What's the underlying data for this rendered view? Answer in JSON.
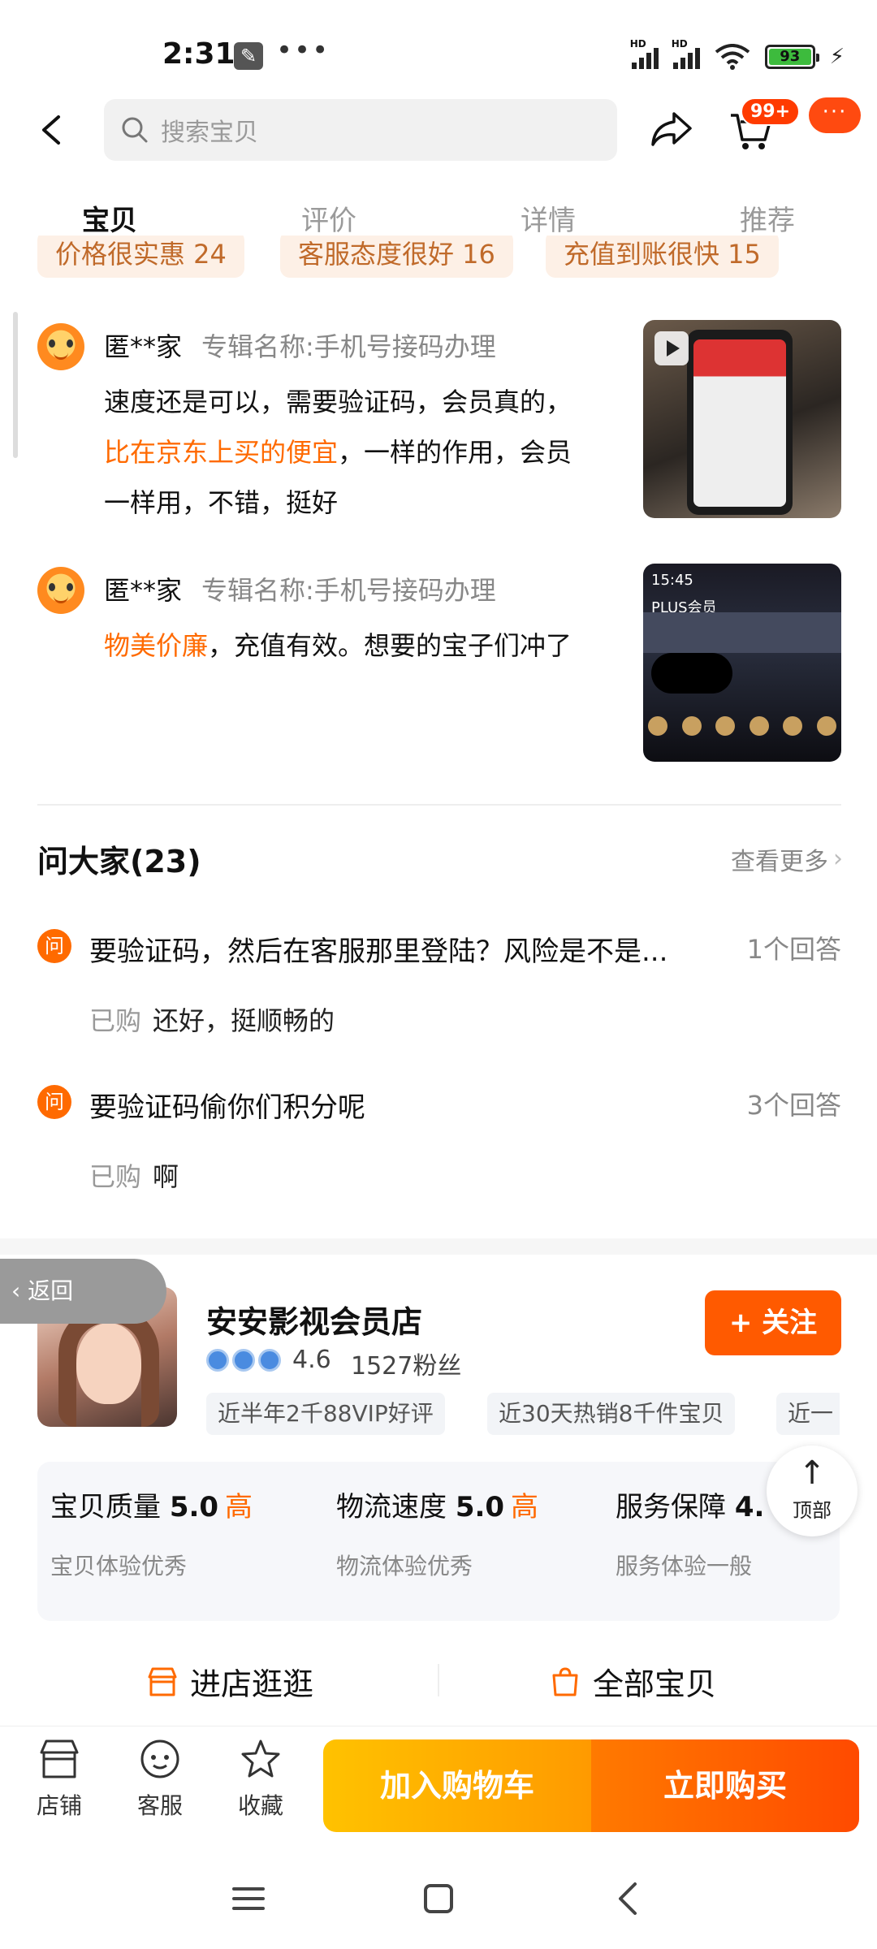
{
  "status_bar": {
    "time": "2:31",
    "battery": "93",
    "network_label": "HD"
  },
  "header": {
    "search_placeholder": "搜索宝贝",
    "cart_badge": "99+",
    "more_label": "···"
  },
  "tabs": [
    {
      "label": "宝贝",
      "active": true
    },
    {
      "label": "评价",
      "active": false
    },
    {
      "label": "详情",
      "active": false
    },
    {
      "label": "推荐",
      "active": false
    }
  ],
  "review_tags": [
    "价格很实惠 24",
    "客服态度很好 16",
    "充值到账很快 15"
  ],
  "reviews": [
    {
      "user": "匿**家",
      "sku": "专辑名称:手机号接码办理",
      "text_before": "速度还是可以，需要验证码，会员真的，",
      "highlight": "比在京东上买的便宜",
      "text_after": "，一样的作用，会员一样用，不错，挺好"
    },
    {
      "user": "匿**家",
      "sku": "专辑名称:手机号接码办理",
      "text_before": "",
      "highlight": "物美价廉",
      "text_after": "，充值有效。想要的宝子们冲了"
    }
  ],
  "review_thumb_text": {
    "time": "15:45",
    "title": "PLUS会员"
  },
  "qa": {
    "title": "问大家(23)",
    "more": "查看更多",
    "icon_char": "问",
    "questions": [
      {
        "q": "要验证码，然后在客服那里登陆？风险是不是...",
        "count": "1个回答",
        "tag": "已购",
        "a": "还好，挺顺畅的"
      },
      {
        "q": "要验证码偷你们积分呢",
        "count": "3个回答",
        "tag": "已购",
        "a": "啊"
      }
    ]
  },
  "shop": {
    "return_label": "返回",
    "name": "安安影视会员店",
    "follow_label": "+ 关注",
    "rating": "4.6",
    "fans": "1527粉丝",
    "tags": [
      "近半年2千88VIP好评",
      "近30天热销8千件宝贝",
      "近一"
    ],
    "scores": [
      {
        "label": "宝贝质量",
        "score": "5.0",
        "level": "高",
        "sub": "宝贝体验优秀"
      },
      {
        "label": "物流速度",
        "score": "5.0",
        "level": "高",
        "sub": "物流体验优秀"
      },
      {
        "label": "服务保障",
        "score": "4.",
        "level": "",
        "sub": "服务体验一般"
      }
    ],
    "top_label": "顶部",
    "enter_store": "进店逛逛",
    "all_items": "全部宝贝"
  },
  "action_bar": {
    "store": "店铺",
    "service": "客服",
    "favorite": "收藏",
    "add_cart": "加入购物车",
    "buy_now": "立即购买"
  },
  "colors": {
    "accent": "#ff5a00",
    "highlight": "#ff6a00",
    "tag_bg": "#fdf0e6",
    "tag_text": "#c06a2a"
  }
}
